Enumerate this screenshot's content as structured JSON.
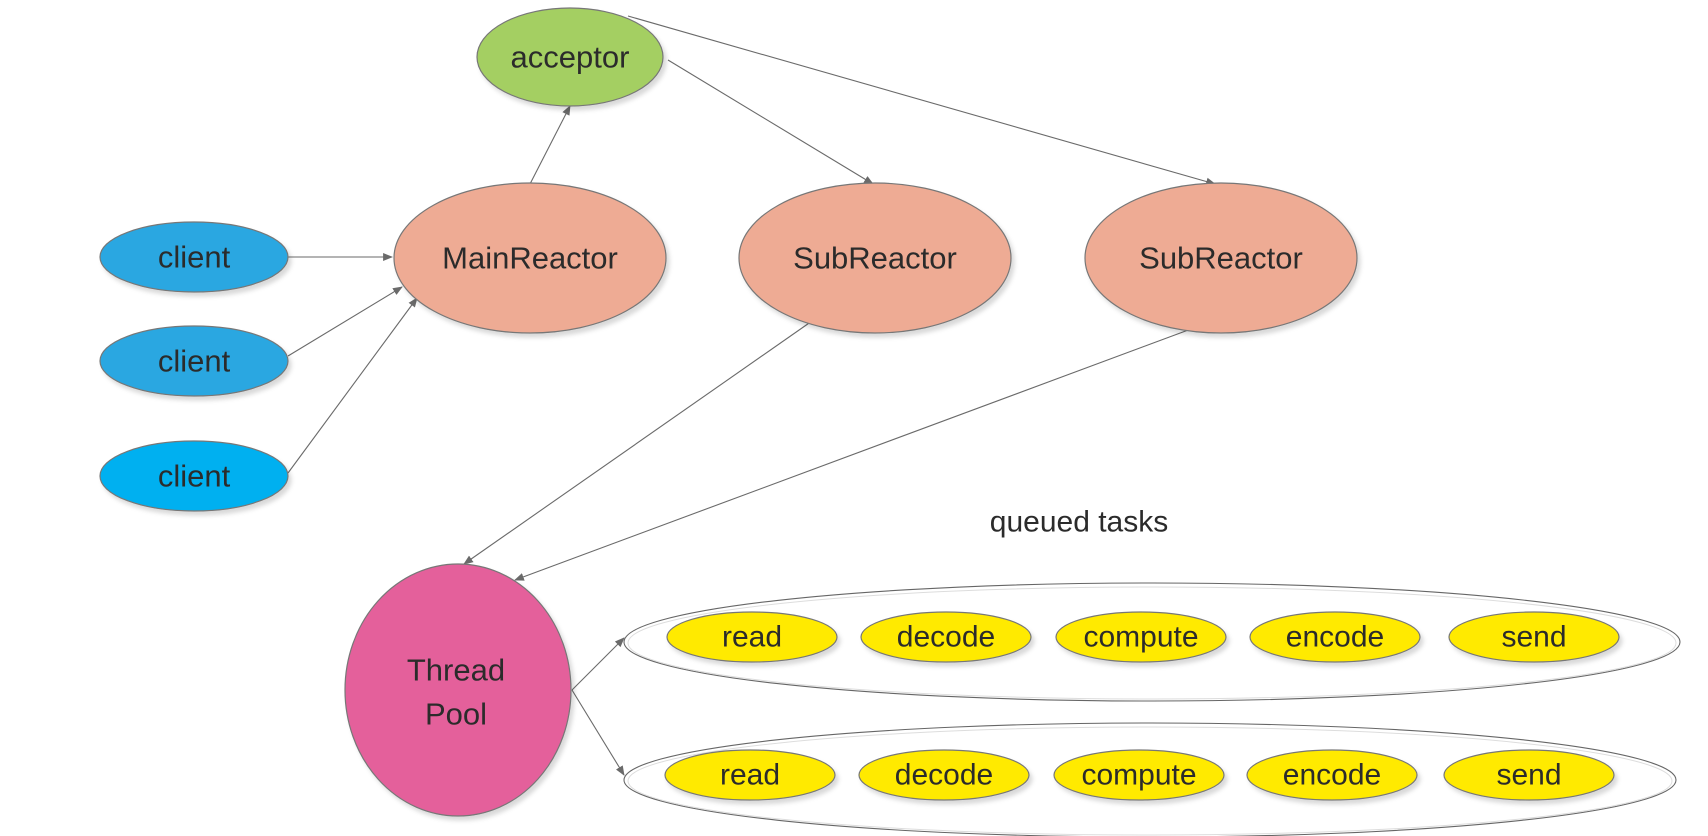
{
  "nodes": {
    "acceptor": {
      "label": "acceptor",
      "color": "#a4cf62"
    },
    "main_reactor": {
      "label": "MainReactor",
      "color": "#eeab94"
    },
    "sub_reactor_1": {
      "label": "SubReactor",
      "color": "#eeab94"
    },
    "sub_reactor_2": {
      "label": "SubReactor",
      "color": "#eeab94"
    },
    "clients": [
      {
        "label": "client",
        "color": "#29a7e1"
      },
      {
        "label": "client",
        "color": "#29a7e1"
      },
      {
        "label": "client",
        "color": "#00b0f0"
      }
    ],
    "thread_pool": {
      "label_line1": "Thread",
      "label_line2": "Pool",
      "color": "#e4609b"
    }
  },
  "queued_tasks": {
    "title": "queued tasks",
    "task_color": "#ffea00",
    "queues": [
      {
        "tasks": [
          "read",
          "decode",
          "compute",
          "encode",
          "send"
        ]
      },
      {
        "tasks": [
          "read",
          "decode",
          "compute",
          "encode",
          "send"
        ]
      }
    ]
  },
  "edges": [
    {
      "from": "client",
      "to": "MainReactor"
    },
    {
      "from": "client",
      "to": "MainReactor"
    },
    {
      "from": "client",
      "to": "MainReactor"
    },
    {
      "from": "MainReactor",
      "to": "acceptor"
    },
    {
      "from": "acceptor",
      "to": "SubReactor"
    },
    {
      "from": "acceptor",
      "to": "SubReactor"
    },
    {
      "from": "SubReactor",
      "to": "Thread Pool"
    },
    {
      "from": "SubReactor",
      "to": "Thread Pool"
    },
    {
      "from": "Thread Pool",
      "to": "queued tasks"
    },
    {
      "from": "Thread Pool",
      "to": "queued tasks"
    }
  ]
}
